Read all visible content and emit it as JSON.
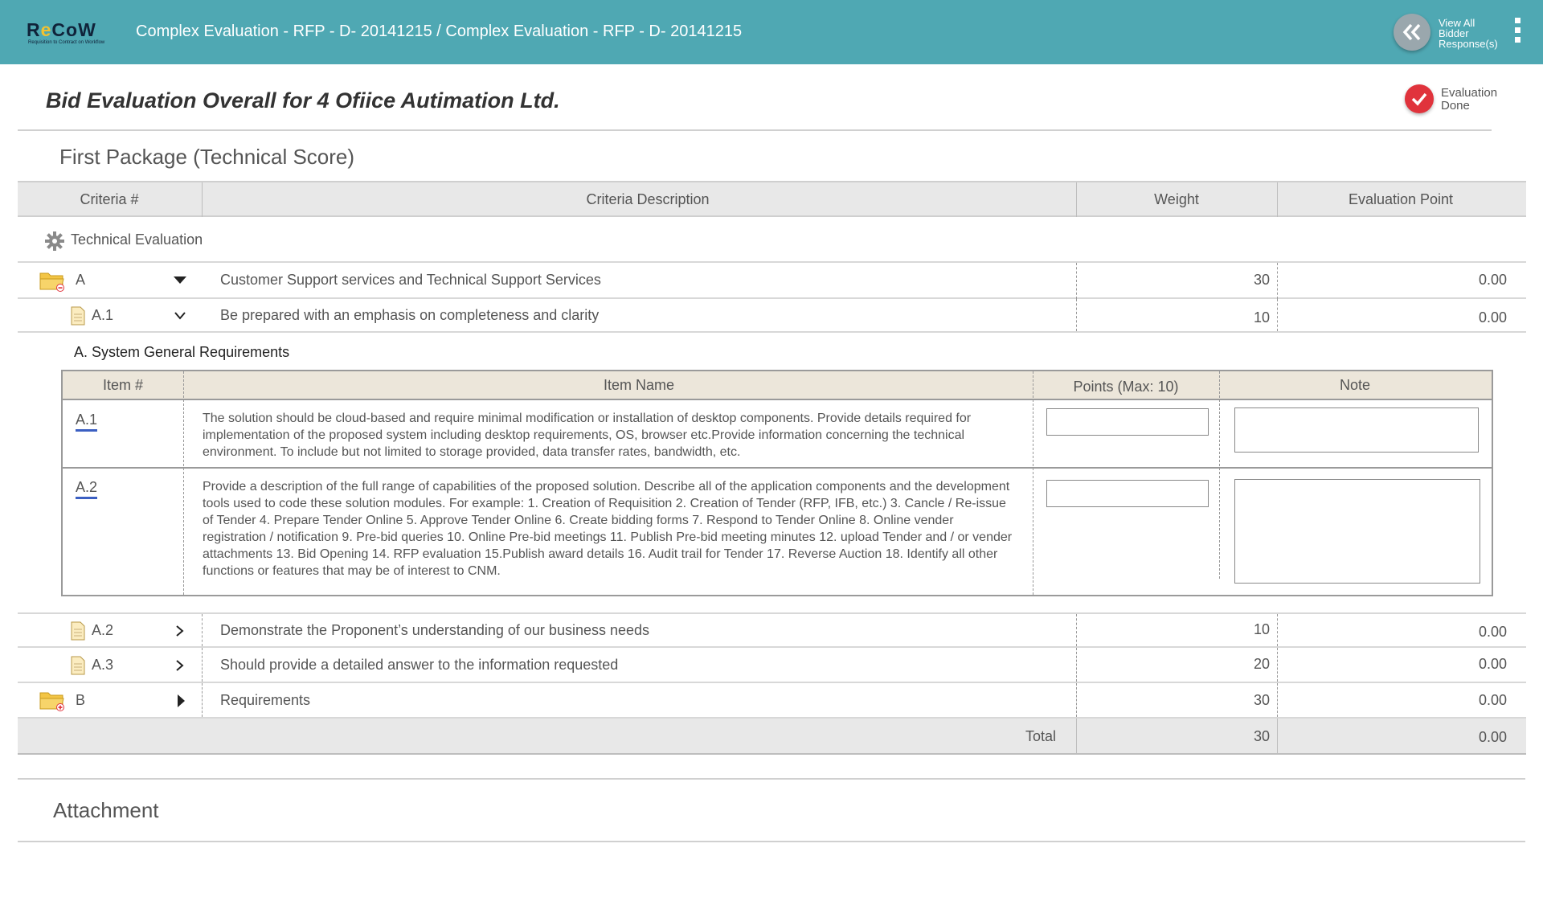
{
  "app": {
    "logo_text": "ReCoW",
    "logo_tagline": "Requisition to Contract on Workflow",
    "breadcrumb": "Complex Evaluation - RFP - D- 20141215 / Complex Evaluation - RFP - D- 20141215",
    "view_all_label": "View All\nBidder\nResponse(s)"
  },
  "header": {
    "title": "Bid Evaluation Overall for 4 Ofiice Autimation Ltd.",
    "eval_done_label": "Evaluation\nDone"
  },
  "package": {
    "title": "First Package (Technical Score)",
    "columns": {
      "criteria_num": "Criteria #",
      "criteria_desc": "Criteria Description",
      "weight": "Weight",
      "evaluation_point": "Evaluation Point"
    },
    "group_label": "Technical Evaluation",
    "rows": [
      {
        "id": "A",
        "desc": "Customer Support services and Technical Support Services",
        "weight": "30",
        "point": "0.00"
      },
      {
        "id": "A.1",
        "desc": "Be prepared with an emphasis on completeness and clarity",
        "weight": "10",
        "point": "0.00"
      },
      {
        "id": "A.2",
        "desc": "Demonstrate the Proponent’s understanding of our business needs",
        "weight": "10",
        "point": "0.00"
      },
      {
        "id": "A.3",
        "desc": "Should provide a detailed answer to the information requested",
        "weight": "20",
        "point": "0.00"
      },
      {
        "id": "B",
        "desc": "Requirements",
        "weight": "30",
        "point": "0.00"
      }
    ],
    "total": {
      "label": "Total",
      "weight": "30",
      "point": "0.00"
    }
  },
  "inner": {
    "caption": "A. System General Requirements",
    "columns": {
      "item_num": "Item #",
      "item_name": "Item Name",
      "points": "Points (Max: 10)",
      "note": "Note"
    },
    "items": [
      {
        "id": "A.1",
        "text": "The solution should be cloud-based and require minimal modification or installation of desktop components. Provide details required for implementation of the proposed system including desktop requirements, OS, browser etc.Provide information concerning the technical environment. To include but not limited to storage provided, data transfer rates, bandwidth, etc.",
        "points": "",
        "note": ""
      },
      {
        "id": "A.2",
        "text": "Provide a description of the full range of capabilities of the proposed solution. Describe all of the application components and the development tools used to code these solution modules. For example: 1. Creation of Requisition 2. Creation of Tender (RFP, IFB, etc.) 3. Cancle / Re-issue of Tender 4. Prepare Tender Online 5. Approve Tender Online 6. Create bidding forms 7. Respond to Tender Online 8. Online vender registration / notification 9. Pre-bid queries 10. Online Pre-bid meetings 11. Publish Pre-bid meeting minutes 12. upload Tender and / or vender attachments 13. Bid Opening 14. RFP evaluation 15.Publish award details 16. Audit trail for Tender 17. Reverse Auction 18. Identify all other functions or features that may be of interest to CNM.",
        "points": "",
        "note": ""
      }
    ]
  },
  "attachment": {
    "title": "Attachment"
  },
  "icons": {
    "back": "double-chevron-left-icon",
    "kebab": "kebab-menu-icon",
    "check": "check-icon",
    "gear": "gear-icon",
    "folder": "folder-icon",
    "document": "document-icon",
    "expand": "chevron-down-icon",
    "collapse": "chevron-right-icon"
  },
  "colors": {
    "topbar": "#4fa8b3",
    "eval_done": "#e0333c",
    "inner_header": "#ece6da",
    "link_underline": "#3b5fc2"
  }
}
